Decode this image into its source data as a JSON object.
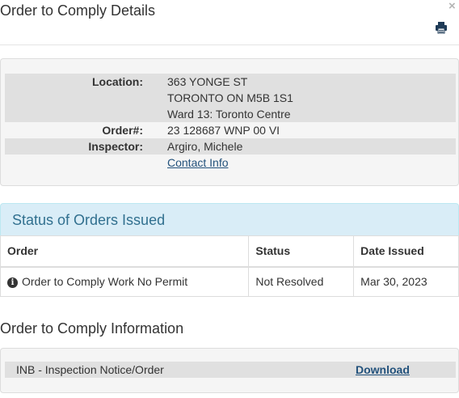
{
  "header": {
    "title": "Order to Comply Details",
    "close_label": "×",
    "print_icon": "print-icon"
  },
  "details": {
    "location_label": "Location:",
    "location_lines": [
      "363 YONGE ST",
      "TORONTO ON M5B 1S1",
      "Ward 13: Toronto Centre"
    ],
    "order_label": "Order#:",
    "order_value": "23 128687 WNP 00 VI",
    "inspector_label": "Inspector:",
    "inspector_value": "Argiro, Michele",
    "contact_link": "Contact Info"
  },
  "status": {
    "heading": "Status of Orders Issued",
    "columns": [
      "Order",
      "Status",
      "Date Issued"
    ],
    "rows": [
      {
        "order": "Order to Comply Work No Permit",
        "status": "Not Resolved",
        "date": "Mar 30, 2023"
      }
    ]
  },
  "information": {
    "title": "Order to Comply Information",
    "document": "INB - Inspection Notice/Order",
    "download_label": "Download"
  },
  "colors": {
    "link": "#23527c",
    "heading_bg": "#d9edf7",
    "heading_text": "#31708f"
  }
}
